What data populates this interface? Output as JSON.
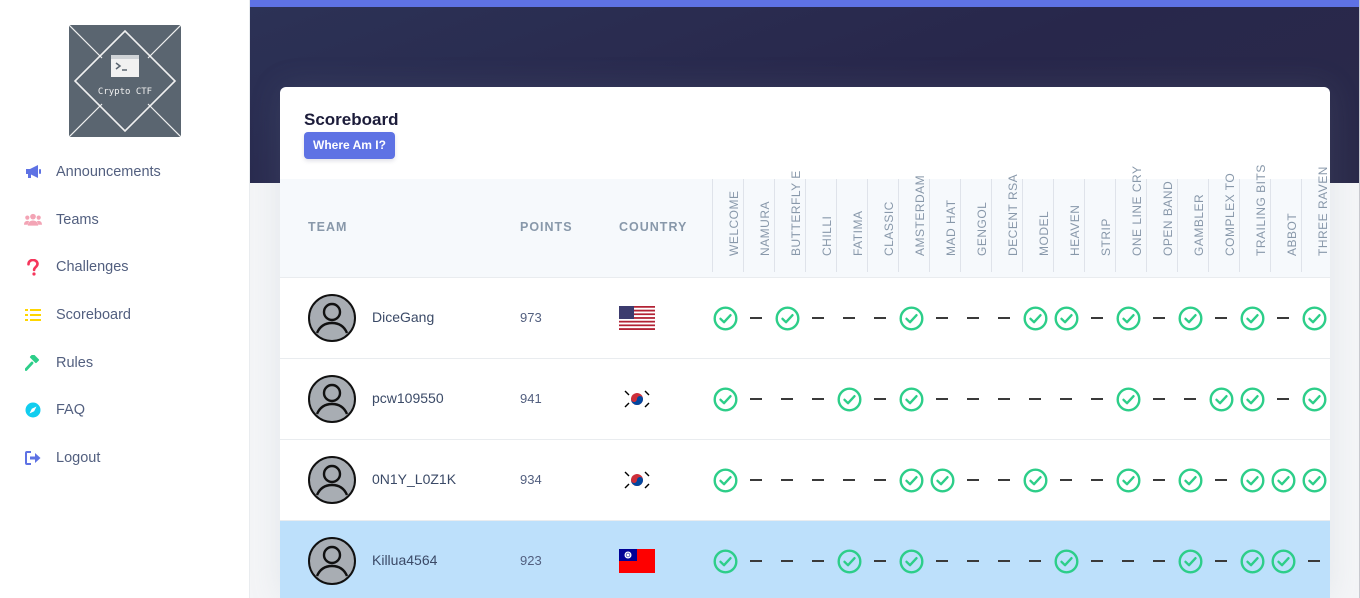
{
  "sidebar": {
    "logo_text": "Crypto CTF",
    "items": [
      {
        "label": "Announcements",
        "icon": "megaphone-icon",
        "color": "#5e72e4"
      },
      {
        "label": "Teams",
        "icon": "users-icon",
        "color": "#f3a4b5"
      },
      {
        "label": "Challenges",
        "icon": "question-icon",
        "color": "#f5365c"
      },
      {
        "label": "Scoreboard",
        "icon": "list-icon",
        "color": "#ffd600"
      },
      {
        "label": "Rules",
        "icon": "gavel-icon",
        "color": "#2dce89"
      },
      {
        "label": "FAQ",
        "icon": "compass-icon",
        "color": "#11cdef"
      },
      {
        "label": "Logout",
        "icon": "sign-out-icon",
        "color": "#5e72e4"
      }
    ]
  },
  "scoreboard": {
    "title": "Scoreboard",
    "where_button": "Where Am I?",
    "headers": {
      "team": "TEAM",
      "points": "POINTS",
      "country": "COUNTRY"
    },
    "challenges": [
      "WELCOME",
      "NAMURA",
      "BUTTERFLY E",
      "CHILLI",
      "FATIMA",
      "CLASSIC",
      "AMSTERDAM",
      "MAD HAT",
      "GENGOL",
      "DECENT RSA",
      "MODEL",
      "HEAVEN",
      "STRIP",
      "ONE LINE CRY",
      "OPEN BAND",
      "GAMBLER",
      "COMPLEX TO",
      "TRAILING BITS",
      "ABBOT",
      "THREE RAVEN"
    ],
    "rows": [
      {
        "team": "DiceGang",
        "points": "973",
        "country": "us-flag-icon",
        "solved": [
          1,
          0,
          1,
          0,
          0,
          0,
          1,
          0,
          0,
          0,
          1,
          1,
          0,
          1,
          0,
          1,
          0,
          1,
          0,
          1
        ],
        "highlight": false
      },
      {
        "team": "pcw109550",
        "points": "941",
        "country": "kr-flag-icon",
        "solved": [
          1,
          0,
          0,
          0,
          1,
          0,
          1,
          0,
          0,
          0,
          0,
          0,
          0,
          1,
          0,
          0,
          1,
          1,
          0,
          1
        ],
        "highlight": false
      },
      {
        "team": "0N1Y_L0Z1K",
        "points": "934",
        "country": "kr-flag-icon",
        "solved": [
          1,
          0,
          0,
          0,
          0,
          0,
          1,
          1,
          0,
          0,
          1,
          0,
          0,
          1,
          0,
          1,
          0,
          1,
          1,
          1
        ],
        "highlight": false
      },
      {
        "team": "Killua4564",
        "points": "923",
        "country": "tw-flag-icon",
        "solved": [
          1,
          0,
          0,
          0,
          1,
          0,
          1,
          0,
          0,
          0,
          0,
          1,
          0,
          0,
          0,
          1,
          0,
          1,
          1,
          0
        ],
        "highlight": true
      }
    ],
    "colors": {
      "solved": "#2dce89",
      "primary": "#5e72e4",
      "highlight_row": "#bde0fb"
    }
  }
}
